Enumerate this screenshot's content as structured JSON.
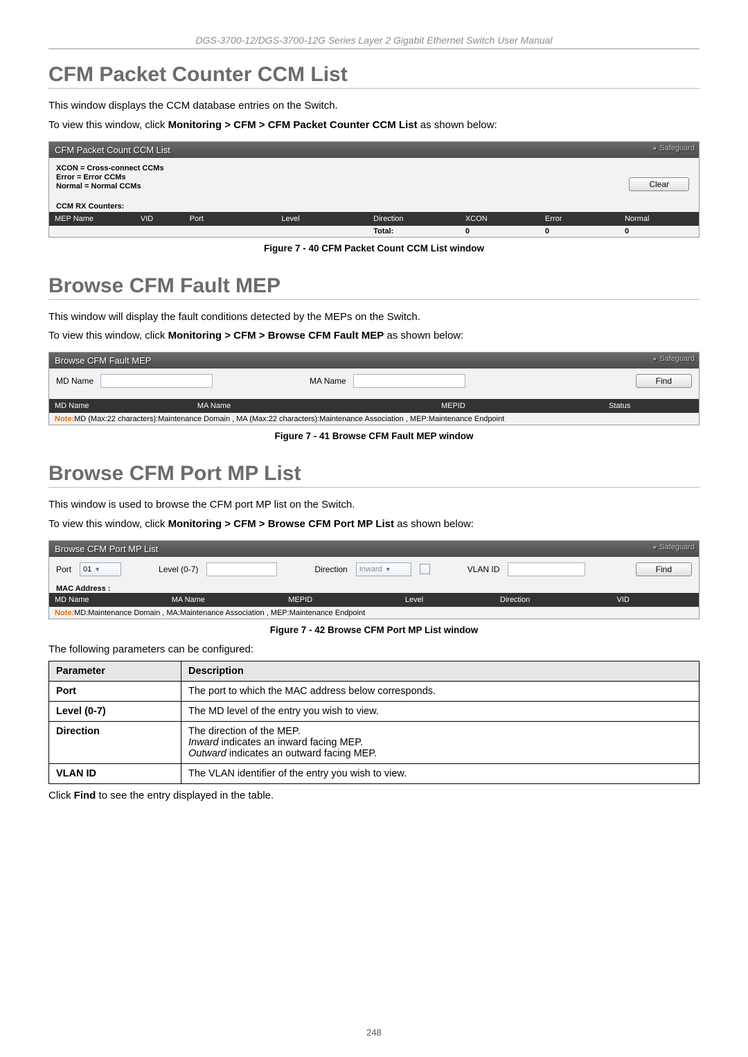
{
  "header_line": "DGS-3700-12/DGS-3700-12G Series Layer 2 Gigabit Ethernet Switch User Manual",
  "page_number": "248",
  "section1": {
    "heading": "CFM Packet Counter CCM List",
    "intro1": "This window displays the CCM database entries on the Switch.",
    "intro2_prefix": "To view this window, click ",
    "intro2_bold": "Monitoring > CFM > CFM Packet Counter CCM List",
    "intro2_suffix": " as shown below:",
    "panel_title": "CFM Packet Count CCM List",
    "safeguard": "Safeguard",
    "legend": [
      "XCON = Cross-connect CCMs",
      "Error = Error CCMs",
      "Normal = Normal CCMs"
    ],
    "clear_btn": "Clear",
    "rx_label": "CCM RX Counters:",
    "cols": [
      "MEP Name",
      "VID",
      "Port",
      "Level",
      "Direction",
      "XCON",
      "Error",
      "Normal"
    ],
    "total_label": "Total:",
    "totals": [
      "0",
      "0",
      "0"
    ],
    "caption": "Figure 7 - 40 CFM Packet Count CCM List window"
  },
  "section2": {
    "heading": "Browse CFM Fault MEP",
    "intro1": "This window will display the fault conditions detected by the MEPs on the Switch.",
    "intro2_prefix": "To view this window, click ",
    "intro2_bold": "Monitoring > CFM > Browse CFM Fault MEP",
    "intro2_suffix": " as shown below:",
    "panel_title": "Browse CFM Fault MEP",
    "safeguard": "Safeguard",
    "md_label": "MD Name",
    "ma_label": "MA Name",
    "find_btn": "Find",
    "cols": [
      "MD Name",
      "MA Name",
      "MEPID",
      "Status"
    ],
    "note_prefix": "Note:",
    "note_text": "MD (Max:22 characters):Maintenance Domain , MA (Max:22 characters):Maintenance Association , MEP:Maintenance Endpoint",
    "caption": "Figure 7 - 41 Browse CFM Fault MEP window"
  },
  "section3": {
    "heading": "Browse CFM Port MP List",
    "intro1": "This window is used to browse the CFM port MP list on the Switch.",
    "intro2_prefix": "To view this window, click ",
    "intro2_bold": "Monitoring > CFM > Browse CFM Port MP List",
    "intro2_suffix": " as shown below:",
    "panel_title": "Browse CFM Port MP List",
    "safeguard": "Safeguard",
    "port_label": "Port",
    "port_value": "01",
    "level_label": "Level (0-7)",
    "direction_label": "Direction",
    "direction_value": "Inward",
    "vlan_label": "VLAN ID",
    "find_btn": "Find",
    "mac_label": "MAC Address :",
    "cols": [
      "MD Name",
      "MA Name",
      "MEPID",
      "Level",
      "Direction",
      "VID"
    ],
    "note_prefix": "Note:",
    "note_text": "MD:Maintenance Domain , MA:Maintenance Association , MEP:Maintenance Endpoint",
    "caption": "Figure 7 - 42 Browse CFM Port MP List window",
    "params_intro": "The following parameters can be configured:"
  },
  "param_table": {
    "head": [
      "Parameter",
      "Description"
    ],
    "rows": [
      {
        "param": "Port",
        "desc_lines": [
          "The port to which the MAC address below corresponds."
        ]
      },
      {
        "param": "Level (0-7)",
        "desc_lines": [
          "The MD level of the entry you wish to view."
        ]
      },
      {
        "param": "Direction",
        "desc_html": "The direction of the MEP.<br><em>Inward</em> indicates an inward facing MEP.<br><em>Outward</em> indicates an outward facing MEP."
      },
      {
        "param": "VLAN ID",
        "desc_lines": [
          "The VLAN identifier of the entry you wish to view."
        ]
      }
    ]
  },
  "closing_prefix": "Click ",
  "closing_bold": "Find",
  "closing_suffix": " to see the entry displayed in the table."
}
